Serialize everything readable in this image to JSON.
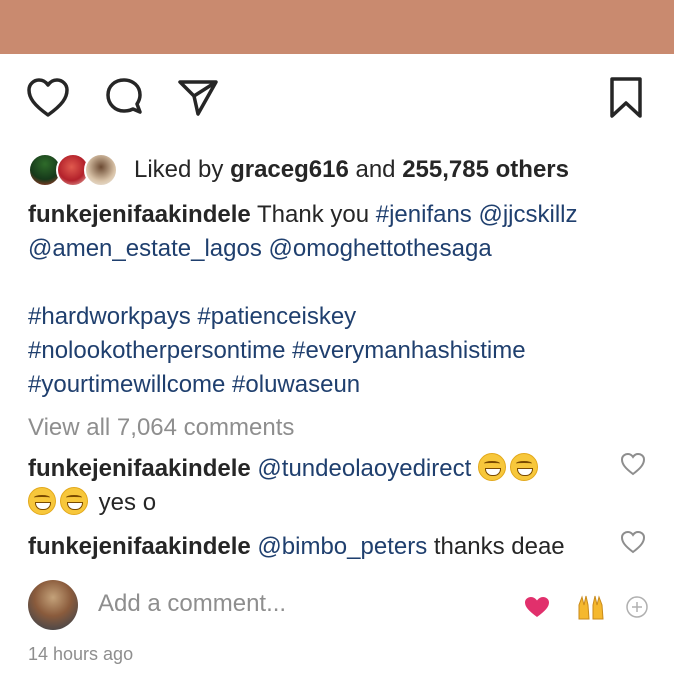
{
  "colors": {
    "top_band": "#c98a6f",
    "link": "#1f3f6e",
    "muted": "#8e8e8e",
    "heart_pink": "#e1306c"
  },
  "actions": {
    "like_icon": "heart-icon",
    "comment_icon": "comment-icon",
    "share_icon": "send-icon",
    "save_icon": "bookmark-icon"
  },
  "likes": {
    "prefix": "Liked by",
    "user": "graceg616",
    "and": "and",
    "others": "255,785 others"
  },
  "caption": {
    "user": "funkejenifaakindele",
    "text": "Thank you",
    "tags_line1": [
      "#jenifans",
      "@jjcskillz"
    ],
    "line2": [
      "@amen_estate_lagos",
      "@omoghettothesaga"
    ],
    "line3": "#hardworkpays #patienceiskey",
    "line4": "#nolookotherpersontime #everymanhashistime",
    "line5": "#yourtimewillcome #oluwaseun"
  },
  "view_all_comments": "View all 7,064 comments",
  "comments": [
    {
      "user": "funkejenifaakindele",
      "mention": "@tundeolaoyedirect",
      "text": "yes o"
    },
    {
      "user": "funkejenifaakindele",
      "mention": "@bimbo_peters",
      "text": "thanks deae"
    }
  ],
  "add_comment": {
    "placeholder": "Add a comment...",
    "quick_reactions": [
      "heart",
      "raised-hands",
      "add"
    ]
  },
  "timestamp": "14 hours ago"
}
